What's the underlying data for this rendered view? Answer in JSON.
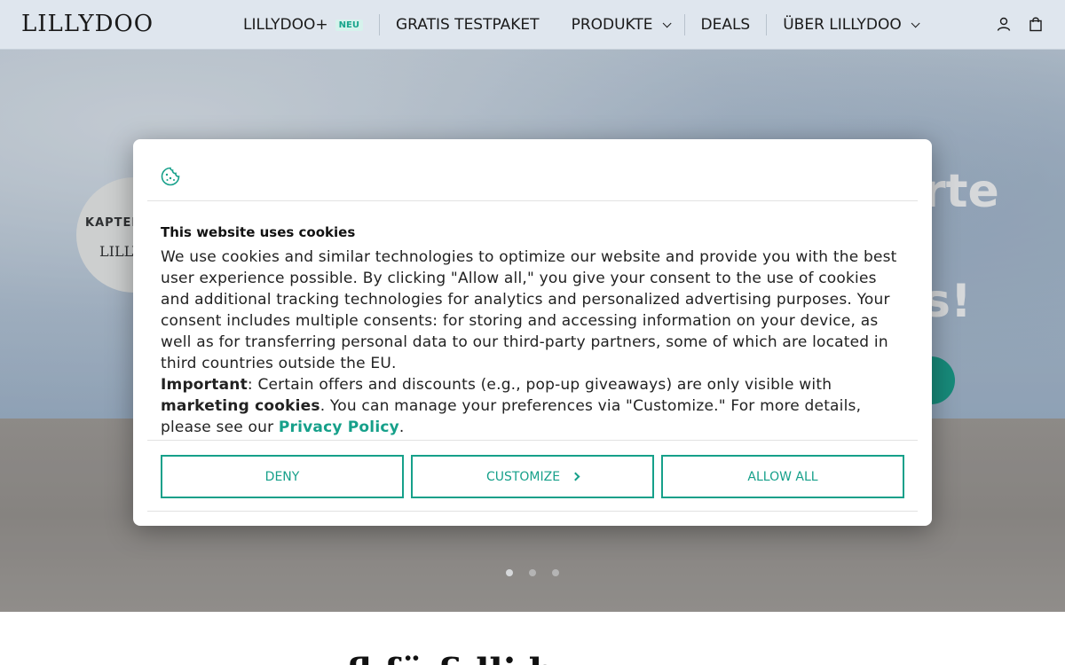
{
  "header": {
    "logo": "LILLYDOO",
    "nav": [
      {
        "label": "LILLYDOO+",
        "badge": "NEU"
      },
      {
        "label": "GRATIS TESTPAKET"
      },
      {
        "label": "PRODUKTE",
        "dropdown": true
      },
      {
        "label": "DEALS"
      },
      {
        "label": "ÜBER LILLYDOO",
        "dropdown": true
      }
    ],
    "icons": [
      "user-icon",
      "shopping-bag-icon"
    ]
  },
  "hero": {
    "circle_text_1": "KAPTEN",
    "circle_text_2": "LILLY",
    "heading_1": "rte",
    "heading_2": "s!",
    "slides": 3,
    "active_slide": 1
  },
  "below": {
    "heading": "fl    fü    fi  lli h"
  },
  "cookie_modal": {
    "icon": "cookie-icon",
    "title": "This website uses cookies",
    "paragraph_1": "We use cookies and similar technologies to optimize our website and provide you with the best user experience possible. By clicking \"Allow all,\" you give your consent to the use of cookies and additional tracking technologies for analytics and personalized advertising purposes. Your consent includes multiple consents: for storing and accessing information on your device, as well as for transferring personal data to our third-party partners, some of which are located in third countries outside the EU.",
    "important_label": "Important",
    "important_text_1": ": Certain offers and discounts (e.g., pop-up giveaways) are only visible with ",
    "marketing_label": "marketing cookies",
    "important_text_2": ". You can manage your preferences via \"Customize.\" For more details, please see our ",
    "privacy_link": "Privacy Policy",
    "period": ".",
    "deny_label": "DENY",
    "customize_label": "CUSTOMIZE",
    "allow_label": "ALLOW ALL"
  },
  "colors": {
    "accent": "#16a08a",
    "header_bg": "#dfe6ee",
    "badge_bg": "#d6f2ec"
  }
}
